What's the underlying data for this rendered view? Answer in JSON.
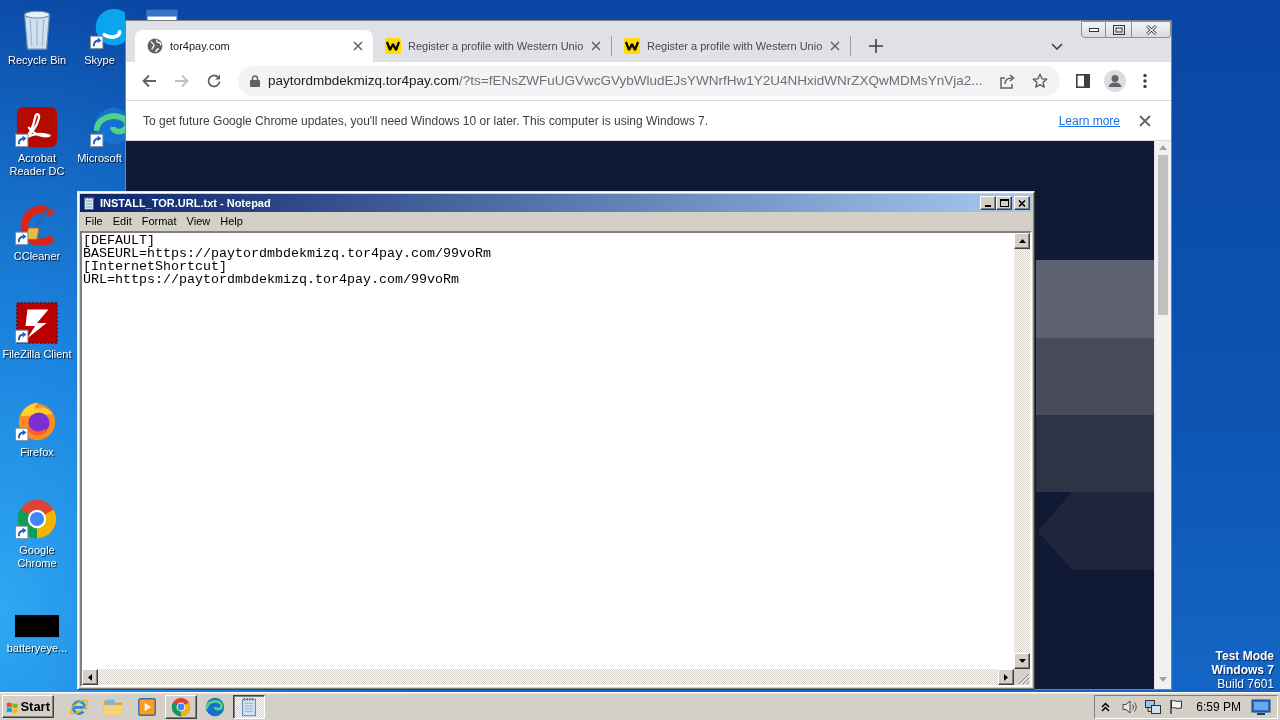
{
  "desktop": {
    "icon_columns": [
      [
        {
          "label": "Recycle Bin",
          "kind": "trash",
          "shortcut": false
        },
        {
          "label": "Acrobat Reader DC",
          "kind": "pdf",
          "shortcut": true
        },
        {
          "label": "CCleaner",
          "kind": "cleaner",
          "shortcut": true
        },
        {
          "label": "FileZilla Client",
          "kind": "ftp",
          "shortcut": true
        },
        {
          "label": "Firefox",
          "kind": "firefox",
          "shortcut": true
        },
        {
          "label": "Google Chrome",
          "kind": "chrome",
          "shortcut": true
        },
        {
          "label": "batteryeye...",
          "kind": "blank",
          "shortcut": false
        }
      ],
      [
        {
          "label": "Skype",
          "kind": "skype",
          "shortcut": true
        },
        {
          "label": "Microsoft",
          "kind": "edge",
          "shortcut": true
        }
      ],
      [
        {
          "kind": "document"
        }
      ]
    ]
  },
  "test_mode_notice": [
    {
      "text": "Test Mode",
      "bold": true
    },
    {
      "text": "Windows 7",
      "bold": true
    },
    {
      "text": "Build 7601",
      "bold": false
    }
  ],
  "browser": {
    "tabs": [
      {
        "title": "tor4pay.com",
        "kind": "globe",
        "selected": true
      },
      {
        "title": "Register a profile with Western Unio",
        "kind": "brand",
        "selected": false
      },
      {
        "title": "Register a profile with Western Unio",
        "kind": "brand",
        "selected": false
      }
    ],
    "back": {
      "disabled": false
    },
    "forward": {
      "disabled": true
    },
    "address": {
      "host": "paytordmbdekmizq.tor4pay.com",
      "rest": "/?ts=fENsZWFuUGVwcGVybWludEJsYWNrfHw1Y2U4NHxidWNrZXQwMDMsYnVja2..."
    },
    "infobar": {
      "message": "To get future Google Chrome updates, you'll need Windows 10 or later. This computer is using Windows 7.",
      "link": "Learn more"
    }
  },
  "notepad": {
    "title": "INSTALL_TOR.URL.txt - Notepad",
    "menu": [
      "File",
      "Edit",
      "Format",
      "View",
      "Help"
    ],
    "lines": [
      "[DEFAULT]",
      "BASEURL=https://paytordmbdekmizq.tor4pay.com/99voRm",
      "[InternetShortcut]",
      "URL=https://paytordmbdekmizq.tor4pay.com/99voRm"
    ]
  },
  "taskbar": {
    "start": "Start",
    "buttons": [
      {
        "kind": "ie",
        "running": false,
        "selected": false
      },
      {
        "kind": "folder",
        "running": false,
        "selected": false
      },
      {
        "kind": "media",
        "running": false,
        "selected": false
      },
      {
        "kind": "chrome",
        "running": true,
        "selected": false
      },
      {
        "kind": "edge",
        "running": false,
        "selected": false
      },
      {
        "kind": "notepad",
        "running": true,
        "selected": true
      }
    ],
    "clock": "6:59 PM"
  }
}
